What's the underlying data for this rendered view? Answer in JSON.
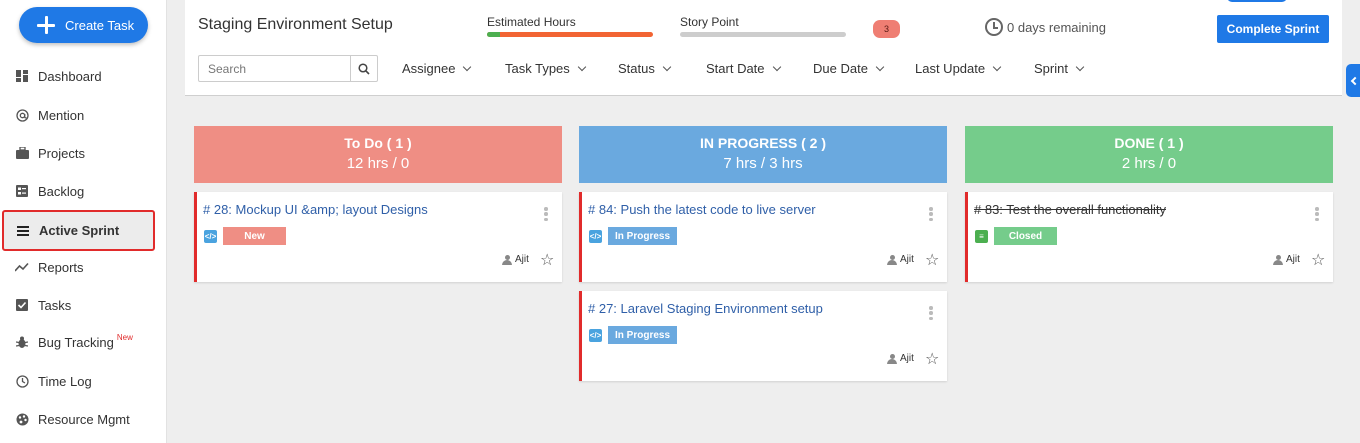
{
  "sidebar": {
    "create_label": "Create Task",
    "items": [
      {
        "label": "Dashboard",
        "icon": "dashboard-icon"
      },
      {
        "label": "Mention",
        "icon": "at-icon"
      },
      {
        "label": "Projects",
        "icon": "briefcase-icon"
      },
      {
        "label": "Backlog",
        "icon": "backlog-icon"
      },
      {
        "label": "Active Sprint",
        "icon": "menu-icon",
        "active": true
      },
      {
        "label": "Reports",
        "icon": "trend-icon"
      },
      {
        "label": "Tasks",
        "icon": "checkbox-icon"
      },
      {
        "label": "Bug Tracking",
        "icon": "bug-icon",
        "tag": "New"
      },
      {
        "label": "Time Log",
        "icon": "clock-icon"
      },
      {
        "label": "Resource Mgmt",
        "icon": "palette-icon"
      }
    ]
  },
  "header": {
    "title": "Staging Environment Setup",
    "estimated_label": "Estimated Hours",
    "story_label": "Story Point",
    "story_count": "3",
    "remaining": "0 days remaining",
    "complete_label": "Complete Sprint",
    "search_placeholder": "Search",
    "filters": [
      "Assignee",
      "Task Types",
      "Status",
      "Start Date",
      "Due Date",
      "Last Update",
      "Sprint"
    ]
  },
  "colors": {
    "accent": "#1f79e6",
    "todo": "#ef8e84",
    "in_progress": "#6aa9df",
    "done": "#75cc8b",
    "highlight": "#e12b2b"
  },
  "columns": [
    {
      "title": "To Do ( 1 )",
      "hours": "12 hrs / 0",
      "cards": [
        {
          "title": "# 28: Mockup UI &amp; layout Designs",
          "status": "New",
          "user": "Ajit"
        }
      ]
    },
    {
      "title": "IN PROGRESS ( 2 )",
      "hours": "7 hrs / 3 hrs",
      "cards": [
        {
          "title": "# 84: Push the latest code to live server",
          "status": "In Progress",
          "user": "Ajit"
        },
        {
          "title": "# 27: Laravel Staging Environment setup",
          "status": "In Progress",
          "user": "Ajit"
        }
      ]
    },
    {
      "title": "DONE ( 1 )",
      "hours": "2 hrs / 0",
      "cards": [
        {
          "title": "# 83: Test the overall functionality",
          "status": "Closed",
          "user": "Ajit"
        }
      ]
    }
  ]
}
